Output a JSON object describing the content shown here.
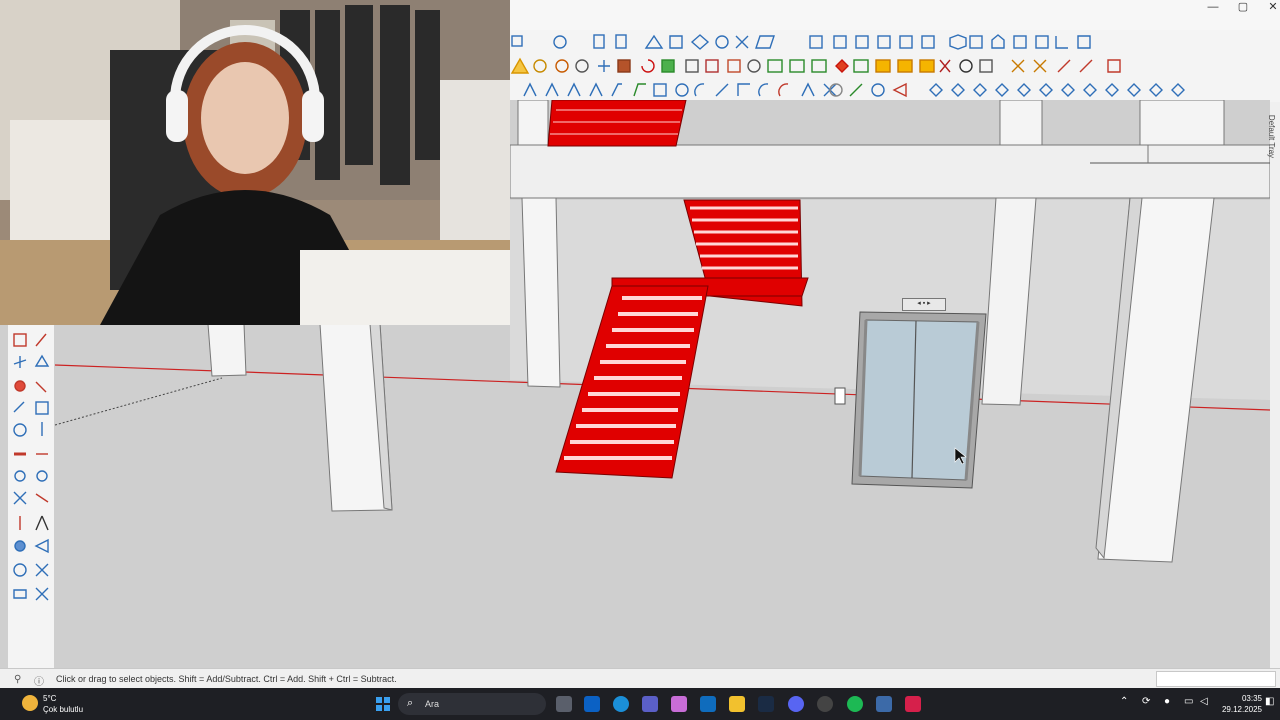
{
  "window": {
    "minimize_glyph": "—",
    "maximize_glyph": "▢",
    "close_glyph": "✕"
  },
  "tray": {
    "label": "Default Tray"
  },
  "status": {
    "hint": "Click or drag to select objects. Shift = Add/Subtract. Ctrl = Add. Shift + Ctrl = Subtract."
  },
  "elevator": {
    "sign_text": "◂ ▪ ▸"
  },
  "taskbar": {
    "weather_temp": "5°C",
    "weather_desc": "Çok bulutlu",
    "search_placeholder": "Ara",
    "time": "03:35",
    "date": "29.12.2025"
  },
  "colors": {
    "stairs": "#e00000",
    "floor": "#d0d0d0",
    "axis_red": "#cc2222",
    "elevator_glass": "#b9cbd6"
  },
  "icons": [
    "select-icon",
    "eraser-icon",
    "paint-bucket-icon",
    "move-icon",
    "rotate-icon",
    "scale-icon",
    "orbit-icon",
    "pan-icon",
    "zoom-icon",
    "zoom-extents-icon",
    "walk-icon",
    "look-around-icon",
    "section-plane-icon"
  ]
}
